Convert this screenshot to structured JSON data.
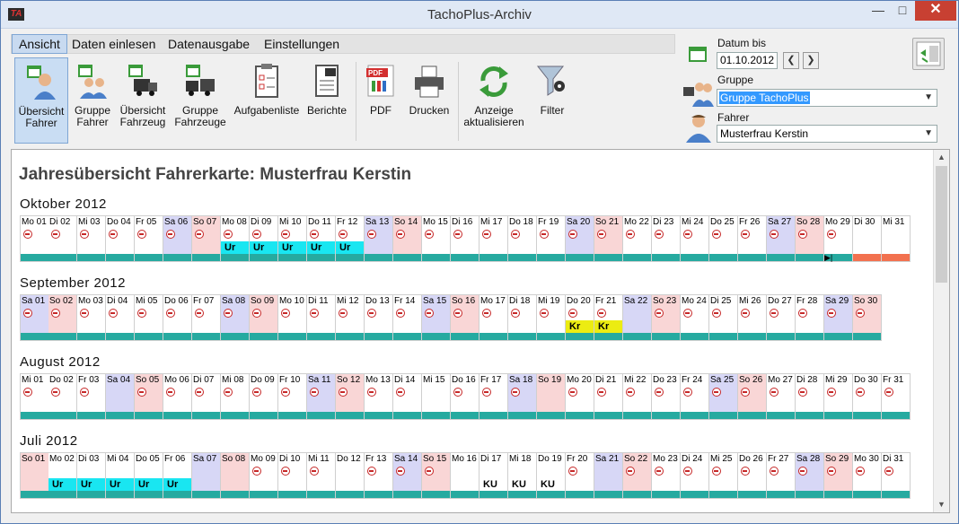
{
  "window": {
    "title": "TachoPlus-Archiv"
  },
  "menu": [
    {
      "label": "Ansicht",
      "active": true
    },
    {
      "label": "Daten einlesen",
      "active": false
    },
    {
      "label": "Datenausgabe",
      "active": false
    },
    {
      "label": "Einstellungen",
      "active": false
    }
  ],
  "toolbar": {
    "uebersicht_fahrer": "Übersicht Fahrer",
    "gruppe_fahrer": "Gruppe Fahrer",
    "uebersicht_fahrzeug": "Übersicht Fahrzeug",
    "gruppe_fahrzeuge": "Gruppe Fahrzeuge",
    "aufgabenliste": "Aufgabenliste",
    "berichte": "Berichte",
    "pdf": "PDF",
    "drucken": "Drucken",
    "anzeige": "Anzeige aktualisieren",
    "filter": "Filter"
  },
  "panel": {
    "datum_label": "Datum bis",
    "datum_value": "01.10.2012",
    "gruppe_label": "Gruppe",
    "gruppe_value": "Gruppe TachoPlus",
    "fahrer_label": "Fahrer",
    "fahrer_value": "Musterfrau Kerstin"
  },
  "page_title": "Jahresübersicht Fahrerkarte: Musterfrau Kerstin",
  "months": [
    {
      "title": "Oktober 2012",
      "days": [
        {
          "label": "Mo 01"
        },
        {
          "label": "Di 02"
        },
        {
          "label": "Mi 03"
        },
        {
          "label": "Do 04"
        },
        {
          "label": "Fr 05"
        },
        {
          "label": "Sa 06",
          "type": "sat"
        },
        {
          "label": "So 07",
          "type": "sun"
        },
        {
          "label": "Mo 08",
          "act": "Ur"
        },
        {
          "label": "Di 09",
          "act": "Ur"
        },
        {
          "label": "Mi 10",
          "act": "Ur"
        },
        {
          "label": "Do 11",
          "act": "Ur"
        },
        {
          "label": "Fr 12",
          "act": "Ur"
        },
        {
          "label": "Sa 13",
          "type": "sat"
        },
        {
          "label": "So 14",
          "type": "sun"
        },
        {
          "label": "Mo 15"
        },
        {
          "label": "Di 16"
        },
        {
          "label": "Mi 17"
        },
        {
          "label": "Do 18"
        },
        {
          "label": "Fr 19"
        },
        {
          "label": "Sa 20",
          "type": "sat"
        },
        {
          "label": "So 21",
          "type": "sun"
        },
        {
          "label": "Mo 22"
        },
        {
          "label": "Di 23"
        },
        {
          "label": "Mi 24"
        },
        {
          "label": "Do 25"
        },
        {
          "label": "Fr 26"
        },
        {
          "label": "Sa 27",
          "type": "sat"
        },
        {
          "label": "So 28",
          "type": "sun"
        },
        {
          "label": "Mo 29",
          "bar": "mark"
        },
        {
          "label": "Di 30",
          "wheel": false,
          "bar": "red"
        },
        {
          "label": "Mi 31",
          "wheel": false,
          "bar": "red"
        }
      ]
    },
    {
      "title": "September 2012",
      "days": [
        {
          "label": "Sa 01",
          "type": "sat"
        },
        {
          "label": "So 02",
          "type": "sun"
        },
        {
          "label": "Mo 03"
        },
        {
          "label": "Di 04"
        },
        {
          "label": "Mi 05"
        },
        {
          "label": "Do 06"
        },
        {
          "label": "Fr 07"
        },
        {
          "label": "Sa 08",
          "type": "sat"
        },
        {
          "label": "So 09",
          "type": "sun"
        },
        {
          "label": "Mo 10"
        },
        {
          "label": "Di 11"
        },
        {
          "label": "Mi 12"
        },
        {
          "label": "Do 13"
        },
        {
          "label": "Fr 14"
        },
        {
          "label": "Sa 15",
          "type": "sat"
        },
        {
          "label": "So 16",
          "type": "sun"
        },
        {
          "label": "Mo 17"
        },
        {
          "label": "Di 18"
        },
        {
          "label": "Mi 19"
        },
        {
          "label": "Do 20",
          "act": "Kr"
        },
        {
          "label": "Fr 21",
          "act": "Kr"
        },
        {
          "label": "Sa 22",
          "type": "sat",
          "wheel": false
        },
        {
          "label": "So 23",
          "type": "sun"
        },
        {
          "label": "Mo 24"
        },
        {
          "label": "Di 25"
        },
        {
          "label": "Mi 26"
        },
        {
          "label": "Do 27"
        },
        {
          "label": "Fr 28"
        },
        {
          "label": "Sa 29",
          "type": "sat"
        },
        {
          "label": "So 30",
          "type": "sun"
        }
      ]
    },
    {
      "title": "August 2012",
      "days": [
        {
          "label": "Mi 01"
        },
        {
          "label": "Do 02"
        },
        {
          "label": "Fr 03"
        },
        {
          "label": "Sa 04",
          "type": "sat",
          "wheel": false
        },
        {
          "label": "So 05",
          "type": "sun"
        },
        {
          "label": "Mo 06"
        },
        {
          "label": "Di 07"
        },
        {
          "label": "Mi 08"
        },
        {
          "label": "Do 09"
        },
        {
          "label": "Fr 10"
        },
        {
          "label": "Sa 11",
          "type": "sat"
        },
        {
          "label": "So 12",
          "type": "sun"
        },
        {
          "label": "Mo 13"
        },
        {
          "label": "Di 14"
        },
        {
          "label": "Mi 15",
          "wheel": false
        },
        {
          "label": "Do 16"
        },
        {
          "label": "Fr 17"
        },
        {
          "label": "Sa 18",
          "type": "sat"
        },
        {
          "label": "So 19",
          "type": "sun",
          "wheel": false
        },
        {
          "label": "Mo 20"
        },
        {
          "label": "Di 21"
        },
        {
          "label": "Mi 22"
        },
        {
          "label": "Do 23"
        },
        {
          "label": "Fr 24"
        },
        {
          "label": "Sa 25",
          "type": "sat"
        },
        {
          "label": "So 26",
          "type": "sun"
        },
        {
          "label": "Mo 27"
        },
        {
          "label": "Di 28"
        },
        {
          "label": "Mi 29"
        },
        {
          "label": "Do 30"
        },
        {
          "label": "Fr 31"
        }
      ]
    },
    {
      "title": "Juli 2012",
      "days": [
        {
          "label": "So 01",
          "type": "sun",
          "wheel": false
        },
        {
          "label": "Mo 02",
          "wheel": false,
          "act": "Ur"
        },
        {
          "label": "Di 03",
          "wheel": false,
          "act": "Ur"
        },
        {
          "label": "Mi 04",
          "wheel": false,
          "act": "Ur"
        },
        {
          "label": "Do 05",
          "wheel": false,
          "act": "Ur"
        },
        {
          "label": "Fr 06",
          "wheel": false,
          "act": "Ur"
        },
        {
          "label": "Sa 07",
          "type": "sat",
          "wheel": false
        },
        {
          "label": "So 08",
          "type": "sun",
          "wheel": false
        },
        {
          "label": "Mo 09"
        },
        {
          "label": "Di 10"
        },
        {
          "label": "Mi 11"
        },
        {
          "label": "Do 12",
          "wheel": false
        },
        {
          "label": "Fr 13"
        },
        {
          "label": "Sa 14",
          "type": "sat"
        },
        {
          "label": "So 15",
          "type": "sun"
        },
        {
          "label": "Mo 16",
          "wheel": false
        },
        {
          "label": "Di 17",
          "wheel": false,
          "act": "KU"
        },
        {
          "label": "Mi 18",
          "wheel": false,
          "act": "KU"
        },
        {
          "label": "Do 19",
          "wheel": false,
          "act": "KU"
        },
        {
          "label": "Fr 20"
        },
        {
          "label": "Sa 21",
          "type": "sat",
          "wheel": false
        },
        {
          "label": "So 22",
          "type": "sun"
        },
        {
          "label": "Mo 23"
        },
        {
          "label": "Di 24"
        },
        {
          "label": "Mi 25"
        },
        {
          "label": "Do 26"
        },
        {
          "label": "Fr 27"
        },
        {
          "label": "Sa 28",
          "type": "sat"
        },
        {
          "label": "So 29",
          "type": "sun"
        },
        {
          "label": "Mo 30"
        },
        {
          "label": "Di 31"
        }
      ]
    }
  ],
  "colors": {
    "urlaub": "#19e6f1",
    "krank": "#ecec12",
    "arbeit_bar": "#26aaa0",
    "no_data_bar": "#f2714f",
    "saturday": "#d7d7f6",
    "sunday": "#f9d6d6"
  }
}
